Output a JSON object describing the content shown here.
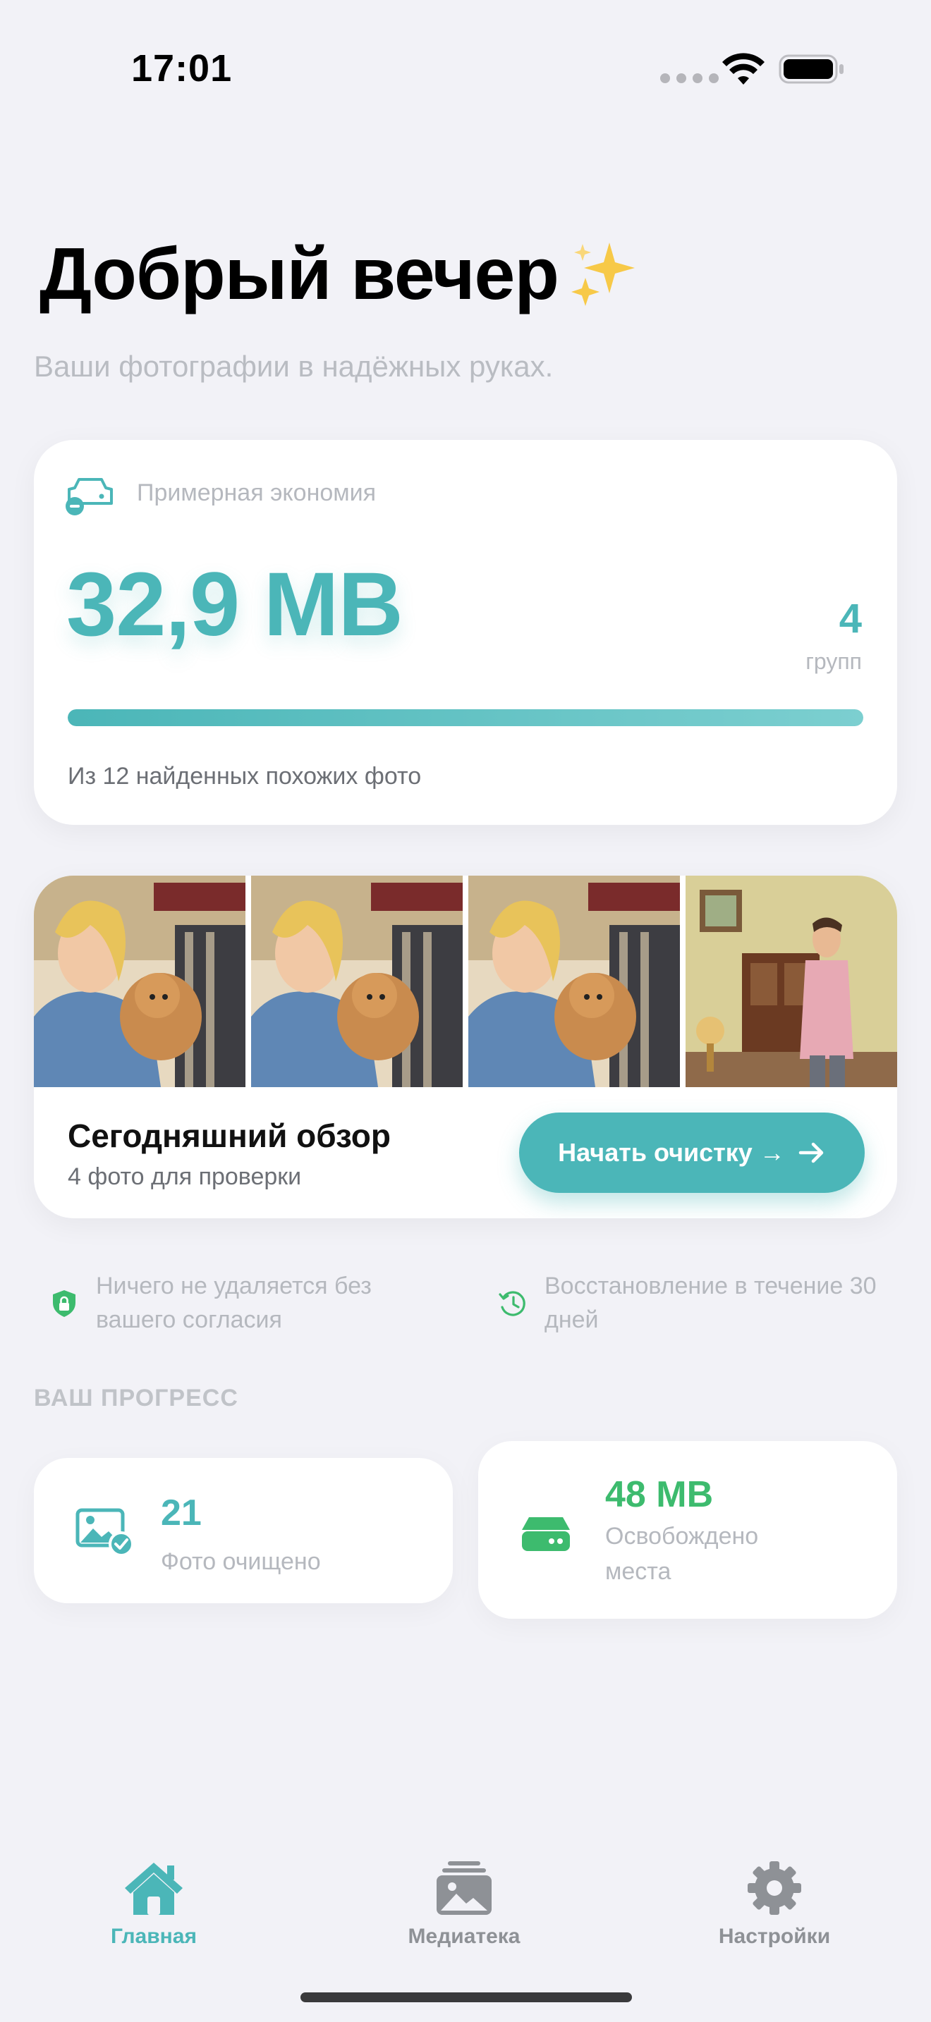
{
  "status_bar": {
    "time": "17:01"
  },
  "header": {
    "greeting": "Добрый вечер",
    "subtitle": "Ваши фотографии в надёжных руках."
  },
  "savings": {
    "label": "Примерная экономия",
    "value": "32,9 MB",
    "groups_count": "4",
    "groups_label": "групп",
    "progress": 1.0,
    "found_text": "Из 12 найденных похожих фото"
  },
  "review": {
    "title": "Сегодняшний обзор",
    "subtitle": "4 фото для проверки",
    "button_label": "Начать очистку →"
  },
  "info": {
    "no_delete": "Ничего не удаляется без вашего согласия",
    "restore": "Восстановление в течение 30 дней"
  },
  "progress_section": {
    "header": "ВАШ ПРОГРЕСС",
    "photos_cleaned_value": "21",
    "photos_cleaned_label": "Фото очищено",
    "space_freed_value": "48 MB",
    "space_freed_label": "Освобождено места"
  },
  "tab_bar": {
    "home": "Главная",
    "library": "Медиатека",
    "settings": "Настройки"
  },
  "colors": {
    "accent": "#4bb6b8",
    "green": "#3dbb6e",
    "background": "#f2f2f7"
  }
}
